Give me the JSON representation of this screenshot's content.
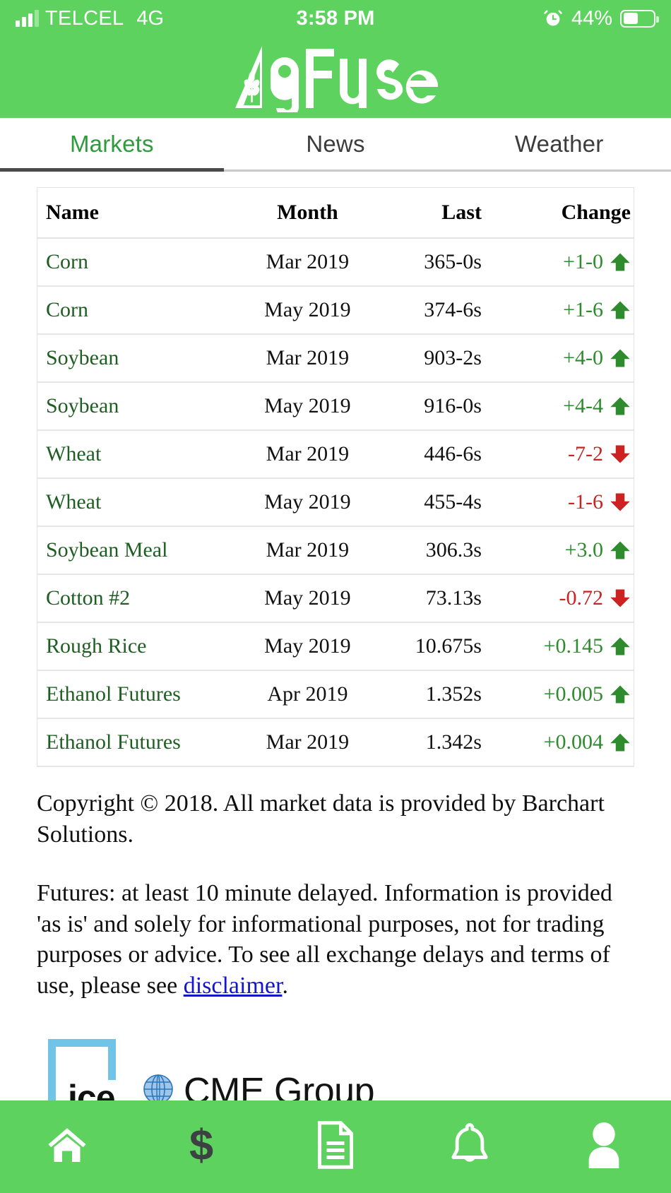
{
  "status_bar": {
    "carrier": "TELCEL",
    "network": "4G",
    "time": "3:58 PM",
    "battery_percent": "44%",
    "battery_level": 44,
    "alarm_icon": "alarm-clock-icon",
    "signal_icon": "signal-bars-icon",
    "battery_icon": "battery-icon"
  },
  "header": {
    "brand": "AgFuse",
    "brand_color": "#5ED25E",
    "logo_icon": "agfuse-wheat-logo"
  },
  "tabs": [
    {
      "label": "Markets",
      "active": true
    },
    {
      "label": "News",
      "active": false
    },
    {
      "label": "Weather",
      "active": false
    }
  ],
  "table": {
    "columns": [
      "Name",
      "Month",
      "Last",
      "Change"
    ],
    "rows": [
      {
        "name": "Corn",
        "month": "Mar 2019",
        "last": "365-0s",
        "change": "+1-0",
        "direction": "up"
      },
      {
        "name": "Corn",
        "month": "May 2019",
        "last": "374-6s",
        "change": "+1-6",
        "direction": "up"
      },
      {
        "name": "Soybean",
        "month": "Mar 2019",
        "last": "903-2s",
        "change": "+4-0",
        "direction": "up"
      },
      {
        "name": "Soybean",
        "month": "May 2019",
        "last": "916-0s",
        "change": "+4-4",
        "direction": "up"
      },
      {
        "name": "Wheat",
        "month": "Mar 2019",
        "last": "446-6s",
        "change": "-7-2",
        "direction": "down"
      },
      {
        "name": "Wheat",
        "month": "May 2019",
        "last": "455-4s",
        "change": "-1-6",
        "direction": "down"
      },
      {
        "name": "Soybean Meal",
        "month": "Mar 2019",
        "last": "306.3s",
        "change": "+3.0",
        "direction": "up"
      },
      {
        "name": "Cotton #2",
        "month": "May 2019",
        "last": "73.13s",
        "change": "-0.72",
        "direction": "down"
      },
      {
        "name": "Rough Rice",
        "month": "May 2019",
        "last": "10.675s",
        "change": "+0.145",
        "direction": "up"
      },
      {
        "name": "Ethanol Futures",
        "month": "Apr 2019",
        "last": "1.352s",
        "change": "+0.005",
        "direction": "up"
      },
      {
        "name": "Ethanol Futures",
        "month": "Mar 2019",
        "last": "1.342s",
        "change": "+0.004",
        "direction": "up"
      }
    ],
    "up_color": "#2E8B2E",
    "down_color": "#CC2222",
    "name_color": "#1E5E22"
  },
  "legal": {
    "copyright": "Copyright © 2018. All market data is provided by Barchart Solutions.",
    "disclaimer_before": "Futures: at least 10 minute delayed. Information is provided 'as is' and solely for informational purposes, not for trading purposes or advice. To see all exchange delays and terms of use, please see ",
    "disclaimer_link": "disclaimer",
    "disclaimer_after": "."
  },
  "exchange_logos": [
    {
      "name": "ice",
      "label": "ice",
      "icon": "ice-logo",
      "color": "#6FC4E8"
    },
    {
      "name": "cme-group",
      "label": "CME Group",
      "icon": "cme-group-logo",
      "color": "#2E75B6"
    }
  ],
  "bottom_nav": [
    {
      "icon": "home-icon",
      "label": "Home",
      "active": false
    },
    {
      "icon": "dollar-icon",
      "label": "Markets",
      "active": true
    },
    {
      "icon": "document-icon",
      "label": "Feed",
      "active": false
    },
    {
      "icon": "bell-icon",
      "label": "Alerts",
      "active": false
    },
    {
      "icon": "person-icon",
      "label": "Profile",
      "active": false
    }
  ]
}
